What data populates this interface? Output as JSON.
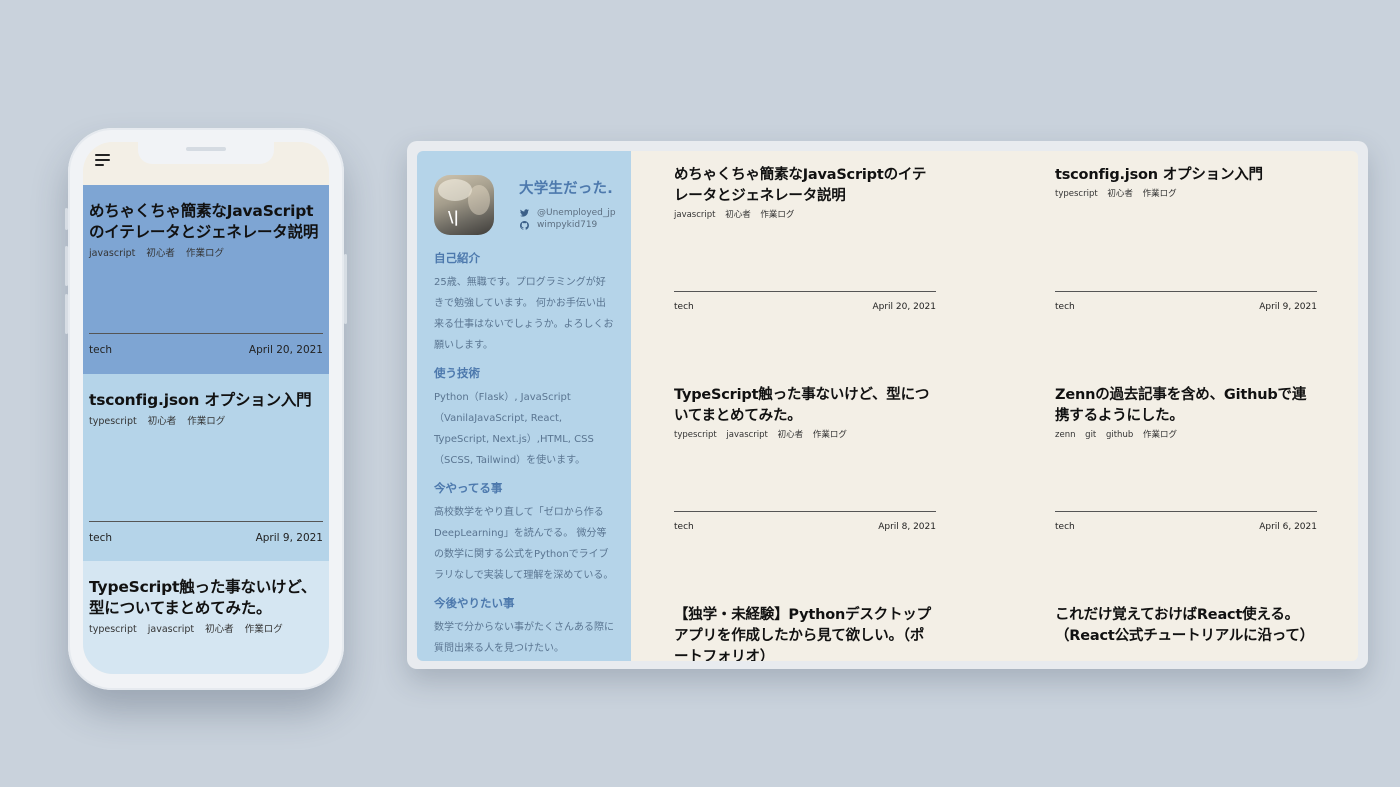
{
  "mobile": {
    "posts": [
      {
        "title": "めちゃくちゃ簡素なJavaScriptのイテレータとジェネレータ説明",
        "tags": [
          "javascript",
          "初心者",
          "作業ログ"
        ],
        "category": "tech",
        "date": "April 20, 2021",
        "bg": "#7ea5d3"
      },
      {
        "title": "tsconfig.json オプション入門",
        "tags": [
          "typescript",
          "初心者",
          "作業ログ"
        ],
        "category": "tech",
        "date": "April 9, 2021",
        "bg": "#b5d4e9"
      },
      {
        "title": "TypeScript触った事ないけど、型についてまとめてみた。",
        "tags": [
          "typescript",
          "javascript",
          "初心者",
          "作業ログ"
        ],
        "category": "tech",
        "date": "April 8, 2021",
        "bg": "#d5e6f2"
      }
    ]
  },
  "sidebar": {
    "site_name": "大学生だった.",
    "twitter": "@Unemployed_jp",
    "github": "wimpykid719",
    "sections": [
      {
        "title": "自己紹介",
        "body": "25歳、無職です。プログラミングが好きで勉強しています。 何かお手伝い出来る仕事はないでしょうか。よろしくお願いします。"
      },
      {
        "title": "使う技術",
        "body": "Python（Flask）, JavaScript（VanilaJavaScript, React, TypeScript, Next.js）,HTML, CSS（SCSS, Tailwind）を使います。"
      },
      {
        "title": "今やってる事",
        "body": "高校数学をやり直して「ゼロから作るDeepLearning」を読んでる。 微分等の数学に関する公式をPythonでライブラリなしで実装して理解を深めている。"
      },
      {
        "title": "今後やりたい事",
        "body": "数学で分からない事がたくさんある際に質問出来る人を見つけたい。"
      }
    ]
  },
  "desktop": {
    "posts": [
      {
        "title": "めちゃくちゃ簡素なJavaScriptのイテレータとジェネレータ説明",
        "tags": [
          "javascript",
          "初心者",
          "作業ログ"
        ],
        "category": "tech",
        "date": "April 20, 2021"
      },
      {
        "title": "tsconfig.json オプション入門",
        "tags": [
          "typescript",
          "初心者",
          "作業ログ"
        ],
        "category": "tech",
        "date": "April 9, 2021"
      },
      {
        "title": "TypeScript触った事ないけど、型についてまとめてみた。",
        "tags": [
          "typescript",
          "javascript",
          "初心者",
          "作業ログ"
        ],
        "category": "tech",
        "date": "April 8, 2021"
      },
      {
        "title": "Zennの過去記事を含め、Githubで連携するようにした。",
        "tags": [
          "zenn",
          "git",
          "github",
          "作業ログ"
        ],
        "category": "tech",
        "date": "April 6, 2021"
      },
      {
        "title": "【独学・未経験】Pythonデスクトップアプリを作成したから見て欲しい。（ポートフォリオ）",
        "tags": [],
        "category": "",
        "date": ""
      },
      {
        "title": "これだけ覚えておけばReact使える。（React公式チュートリアルに沿って）",
        "tags": [],
        "category": "",
        "date": ""
      }
    ]
  }
}
